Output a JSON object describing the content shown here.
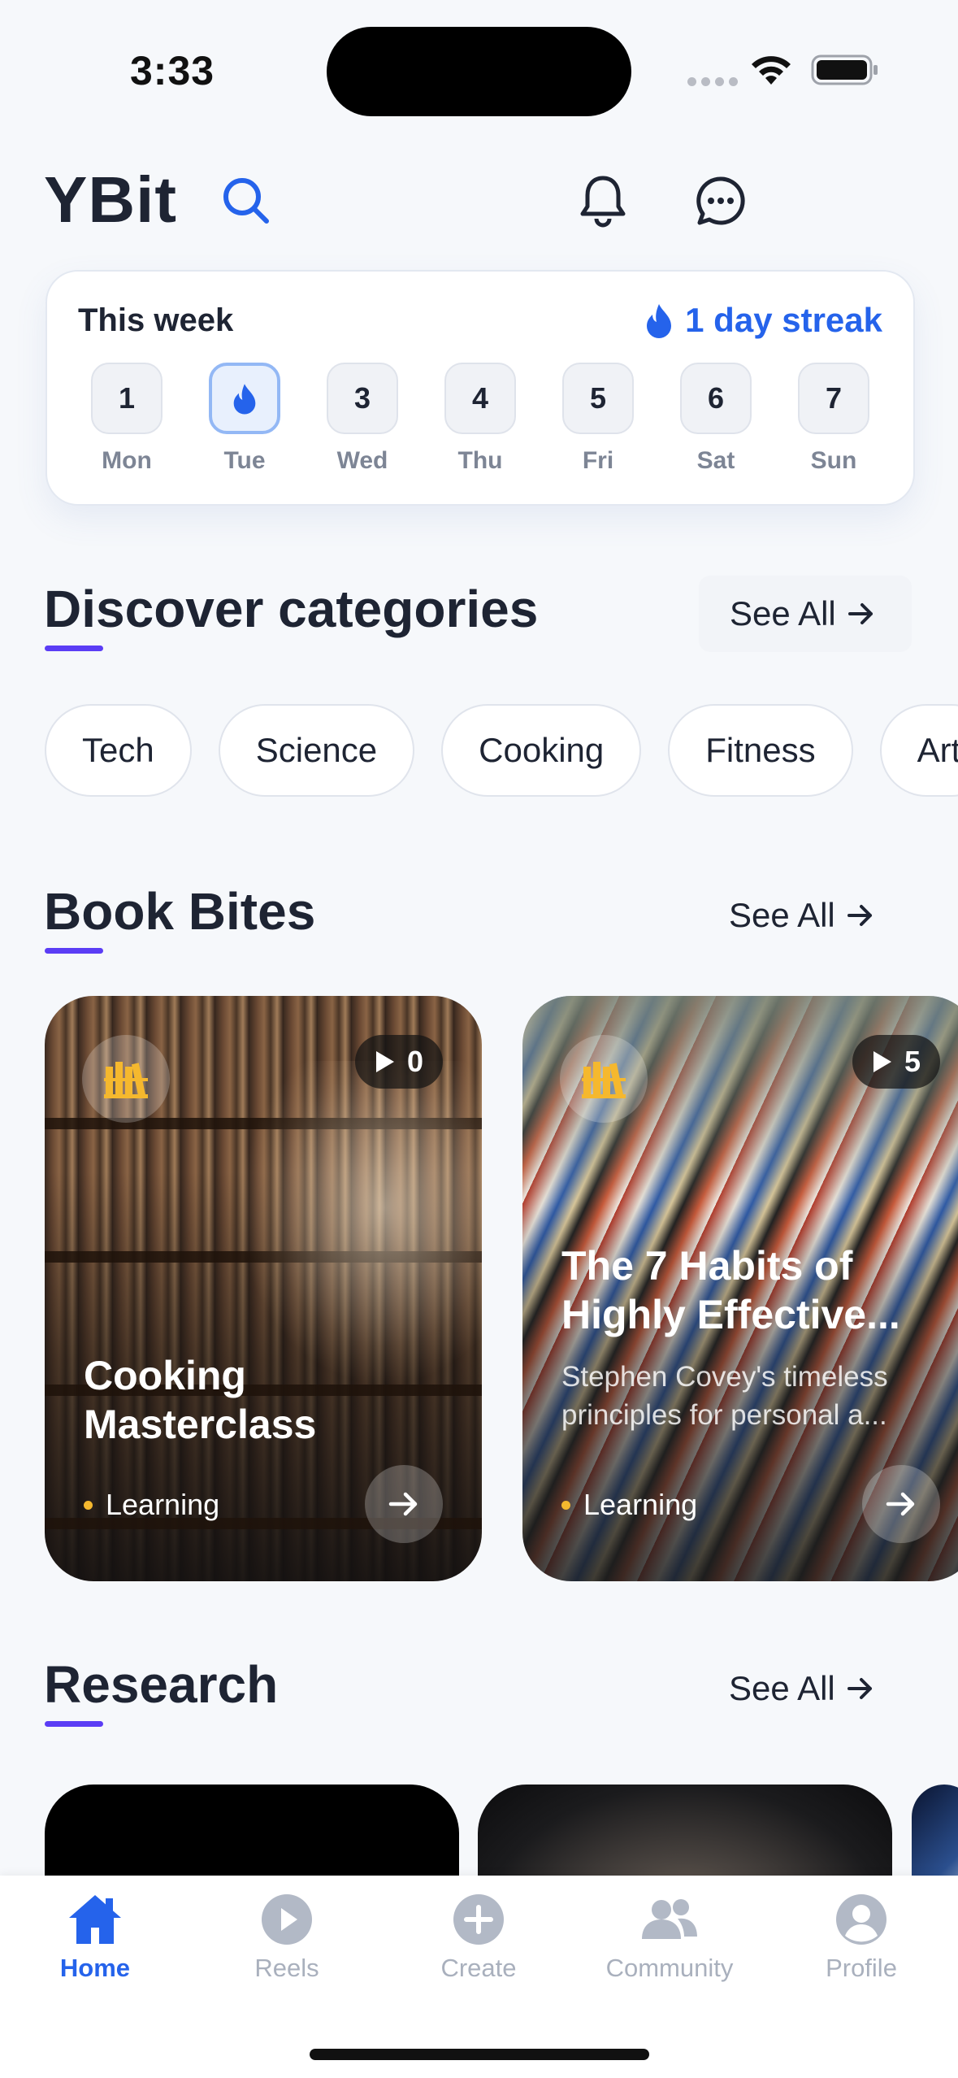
{
  "status_bar": {
    "time": "3:33"
  },
  "header": {
    "brand": "YBit"
  },
  "week": {
    "title": "This week",
    "streak_label": "1 day streak",
    "days": [
      {
        "num": "1",
        "label": "Mon",
        "active": false
      },
      {
        "num": "",
        "label": "Tue",
        "active": true
      },
      {
        "num": "3",
        "label": "Wed",
        "active": false
      },
      {
        "num": "4",
        "label": "Thu",
        "active": false
      },
      {
        "num": "5",
        "label": "Fri",
        "active": false
      },
      {
        "num": "6",
        "label": "Sat",
        "active": false
      },
      {
        "num": "7",
        "label": "Sun",
        "active": false
      }
    ]
  },
  "discover": {
    "title": "Discover categories",
    "see_all": "See All",
    "chips": [
      "Tech",
      "Science",
      "Cooking",
      "Fitness",
      "Art"
    ]
  },
  "book_bites": {
    "title": "Book Bites",
    "see_all": "See All",
    "cards": [
      {
        "plays": "0",
        "title_line1": "Cooking",
        "title_line2": "Masterclass",
        "description": "",
        "tag": "Learning"
      },
      {
        "plays": "5",
        "title_line1": "The 7 Habits of",
        "title_line2": "Highly Effective...",
        "desc_line1": "Stephen Covey's timeless",
        "desc_line2": "principles for personal a...",
        "tag": "Learning"
      }
    ]
  },
  "research": {
    "title": "Research",
    "see_all": "See All"
  },
  "tabbar": {
    "tabs": [
      {
        "label": "Home",
        "icon": "home-icon",
        "active": true
      },
      {
        "label": "Reels",
        "icon": "play-icon",
        "active": false
      },
      {
        "label": "Create",
        "icon": "plus-icon",
        "active": false
      },
      {
        "label": "Community",
        "icon": "community-icon",
        "active": false
      },
      {
        "label": "Profile",
        "icon": "profile-icon",
        "active": false
      }
    ]
  },
  "colors": {
    "accent": "#2563eb",
    "underline": "#5b3df5",
    "tag_dot": "#f5b82e",
    "book_icon": "#f5b82e"
  }
}
